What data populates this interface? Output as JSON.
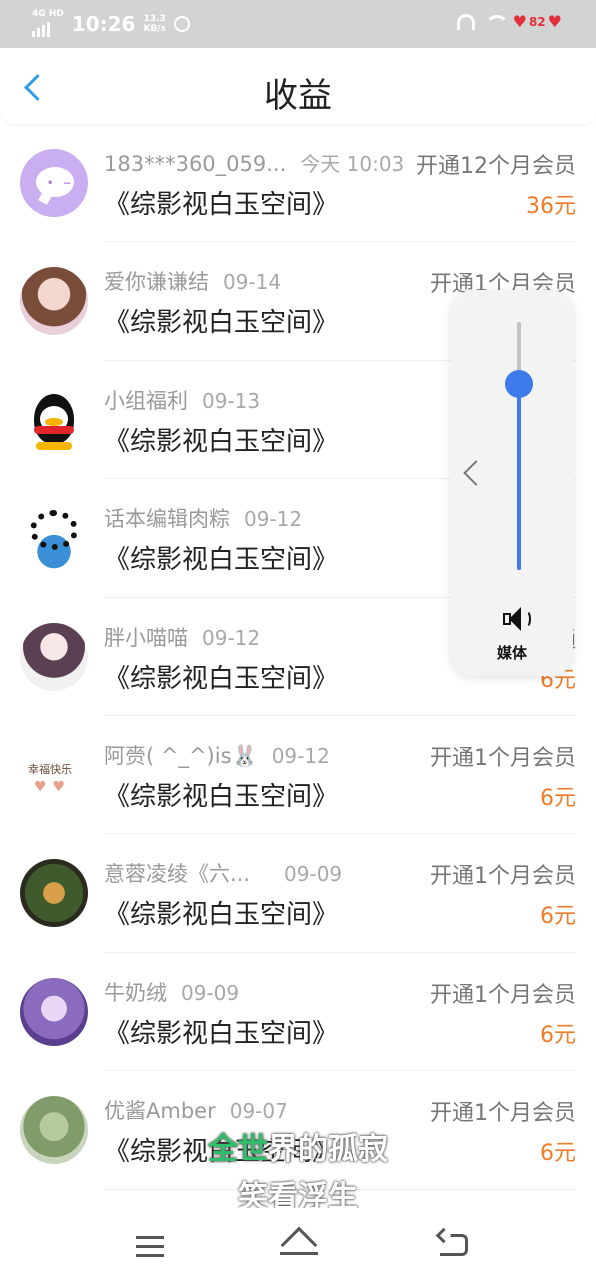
{
  "status_bar": {
    "network": "4G HD",
    "time": "10:26",
    "speed_value": "13.3",
    "speed_unit": "KB/s",
    "battery": "82",
    "icons": [
      "signal-icon",
      "app-icon",
      "headphone-icon",
      "wifi-icon",
      "battery-heart-icon"
    ]
  },
  "header": {
    "title": "收益",
    "back_icon": "chevron-left-icon"
  },
  "rows": [
    {
      "avatar": "chat-bubble-avatar",
      "name": "183***360_059...",
      "date": "今天 10:03",
      "action": "开通12个月会员",
      "book": "《综影视白玉空间》",
      "amount": "36元"
    },
    {
      "avatar": "girl-avatar",
      "name": "爱你谦谦结",
      "date": "09-14",
      "action": "开通1个月会员",
      "book": "《综影视白玉空间》",
      "amount": ""
    },
    {
      "avatar": "qq-penguin-avatar",
      "name": "小组福利",
      "date": "09-13",
      "action": "",
      "book": "《综影视白玉空间》",
      "amount": ""
    },
    {
      "avatar": "virus-earth-avatar",
      "name": "话本编辑肉粽",
      "date": "09-12",
      "action": "",
      "book": "《综影视白玉空间》",
      "amount": ""
    },
    {
      "avatar": "drawn-girl-avatar",
      "name": "胖小喵喵",
      "date": "09-12",
      "action": "开通",
      "book": "《综影视白玉空间》",
      "amount": "6元"
    },
    {
      "avatar": "happy-hands-avatar",
      "name": "阿赍( ^_^)is🐰",
      "date": "09-12",
      "action": "开通1个月会员",
      "book": "《综影视白玉空间》",
      "amount": "6元"
    },
    {
      "avatar": "heart-wreath-avatar",
      "name": "意蓉凌绫《六...",
      "date": "09-09",
      "action": "开通1个月会员",
      "book": "《综影视白玉空间》",
      "amount": "6元"
    },
    {
      "avatar": "purple-anime-avatar",
      "name": "牛奶绒",
      "date": "09-09",
      "action": "开通1个月会员",
      "book": "《综影视白玉空间》",
      "amount": "6元"
    },
    {
      "avatar": "green-flower-avatar",
      "name": "优酱Amber",
      "date": "09-07",
      "action": "开通1个月会员",
      "book": "《综影视白玉空间》",
      "amount": "6元"
    }
  ],
  "avatar_happy_text": "幸福快乐",
  "volume": {
    "label": "媒体",
    "level": 0.75,
    "speaker_icon": "speaker-icon",
    "collapse_icon": "chevron-left-icon"
  },
  "lyrics": {
    "line1_highlight": "全世",
    "line1_rest": "界的孤寂",
    "line2": "笑看浮生"
  },
  "nav": {
    "menu_icon": "menu-icon",
    "home_icon": "home-icon",
    "back_icon": "back-icon"
  },
  "colors": {
    "accent": "#2f9be6",
    "amount": "#f07b28",
    "volume": "#3d7bea",
    "lyric_highlight": "#2fbf6b"
  }
}
